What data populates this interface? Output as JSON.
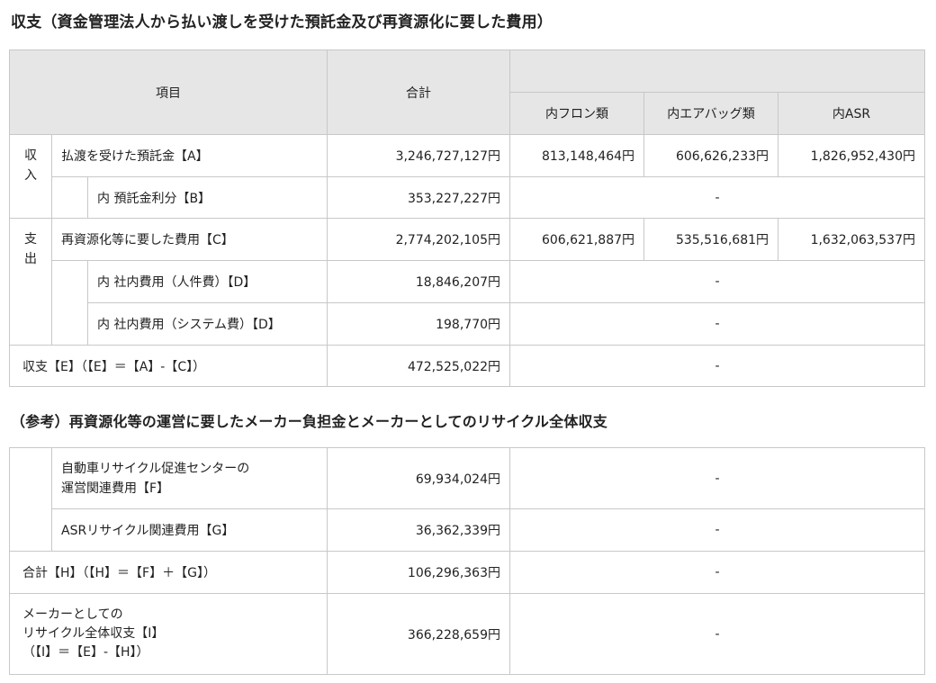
{
  "section1": {
    "title": "収支（資金管理法人から払い渡しを受けた預託金及び再資源化に要した費用）",
    "headers": {
      "item": "項目",
      "total": "合計",
      "freon": "内フロン類",
      "airbag": "内エアバッグ類",
      "asr": "内ASR"
    },
    "income": {
      "label": "収入",
      "row_a": {
        "label": "払渡を受けた預託金【A】",
        "total": "3,246,727,127円",
        "freon": "813,148,464円",
        "airbag": "606,626,233円",
        "asr": "1,826,952,430円"
      },
      "row_b": {
        "label": "内 預託金利分【B】",
        "total": "353,227,227円",
        "rest": "-"
      }
    },
    "expense": {
      "label": "支出",
      "row_c": {
        "label": "再資源化等に要した費用【C】",
        "total": "2,774,202,105円",
        "freon": "606,621,887円",
        "airbag": "535,516,681円",
        "asr": "1,632,063,537円"
      },
      "row_d1": {
        "label": "内 社内費用（人件費）【D】",
        "total": "18,846,207円",
        "rest": "-"
      },
      "row_d2": {
        "label": "内 社内費用（システム費）【D】",
        "total": "198,770円",
        "rest": "-"
      }
    },
    "row_e": {
      "label": "収支【E】（【E】＝【A】-【C】）",
      "total": "472,525,022円",
      "rest": "-"
    }
  },
  "section2": {
    "title": "（参考）再資源化等の運営に要したメーカー負担金とメーカーとしてのリサイクル全体収支",
    "row_f": {
      "label_line1": "自動車リサイクル促進センターの",
      "label_line2": "運営関連費用【F】",
      "total": "69,934,024円",
      "rest": "-"
    },
    "row_g": {
      "label": "ASRリサイクル関連費用【G】",
      "total": "36,362,339円",
      "rest": "-"
    },
    "row_h": {
      "label": "合計【H】（【H】＝【F】＋【G】）",
      "total": "106,296,363円",
      "rest": "-"
    },
    "row_i": {
      "label_line1": "メーカーとしての",
      "label_line2": "リサイクル全体収支【I】",
      "label_line3": "（【I】＝【E】-【H】）",
      "total": "366,228,659円",
      "rest": "-"
    }
  }
}
